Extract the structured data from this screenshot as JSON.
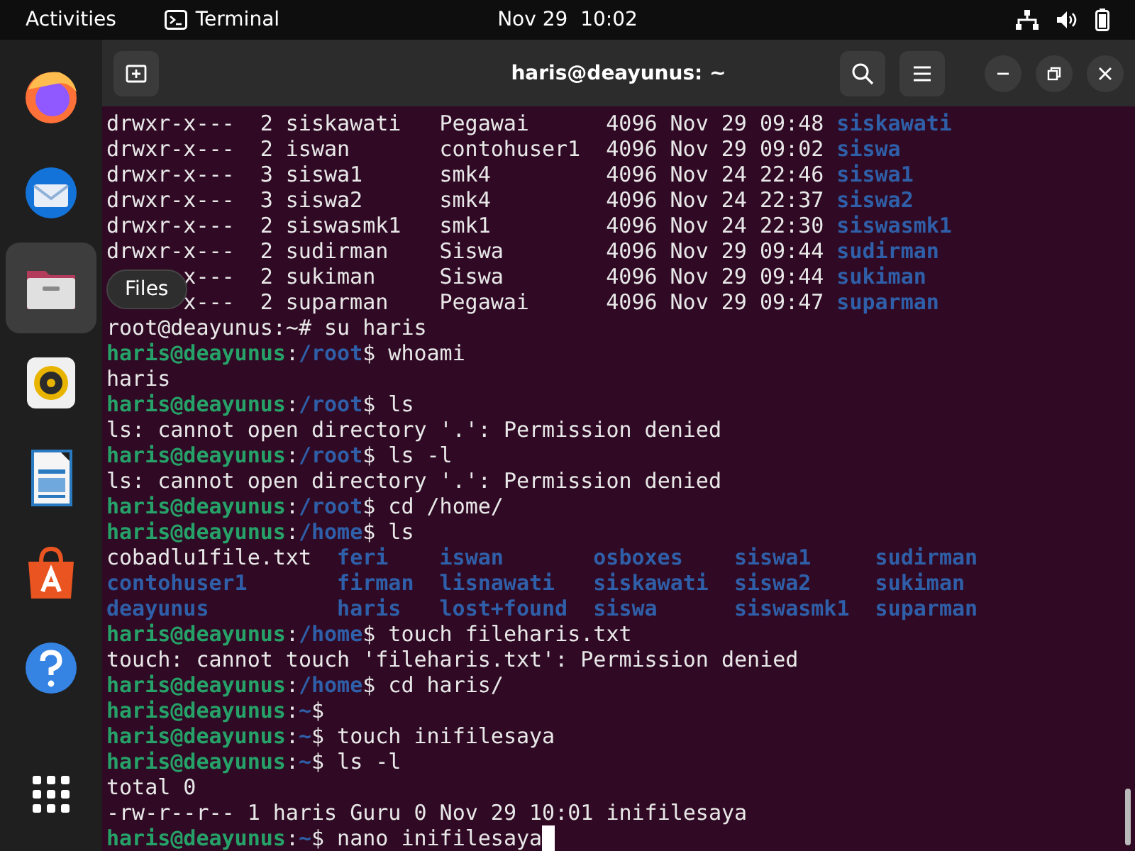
{
  "top_bar": {
    "activities": "Activities",
    "app_name": "Terminal",
    "clock": "Nov 29  10:02"
  },
  "dock": {
    "items": [
      {
        "kind": "firefox",
        "selected": false
      },
      {
        "kind": "thunderbird",
        "selected": false
      },
      {
        "kind": "files",
        "selected": true
      },
      {
        "kind": "rhythmbox",
        "selected": false
      },
      {
        "kind": "writer",
        "selected": false
      },
      {
        "kind": "software",
        "selected": false
      },
      {
        "kind": "help",
        "selected": false
      },
      {
        "kind": "apps",
        "selected": false
      }
    ],
    "tooltip": "Files"
  },
  "window": {
    "title": "haris@deayunus: ~"
  },
  "terminal": {
    "lines": [
      {
        "kind": "listing",
        "perms": "drwxr-x---",
        "links": "2",
        "owner": "siskawati",
        "group": "Pegawai",
        "size": "4096",
        "date": "Nov 29 09:48",
        "name": "siskawati"
      },
      {
        "kind": "listing",
        "perms": "drwxr-x---",
        "links": "2",
        "owner": "iswan",
        "group": "contohuser1",
        "size": "4096",
        "date": "Nov 29 09:02",
        "name": "siswa"
      },
      {
        "kind": "listing",
        "perms": "drwxr-x---",
        "links": "3",
        "owner": "siswa1",
        "group": "smk4",
        "size": "4096",
        "date": "Nov 24 22:46",
        "name": "siswa1"
      },
      {
        "kind": "listing",
        "perms": "drwxr-x---",
        "links": "3",
        "owner": "siswa2",
        "group": "smk4",
        "size": "4096",
        "date": "Nov 24 22:37",
        "name": "siswa2"
      },
      {
        "kind": "listing",
        "perms": "drwxr-x---",
        "links": "2",
        "owner": "siswasmk1",
        "group": "smk1",
        "size": "4096",
        "date": "Nov 24 22:30",
        "name": "siswasmk1"
      },
      {
        "kind": "listing",
        "perms": "drwxr-x---",
        "links": "2",
        "owner": "sudirman",
        "group": "Siswa",
        "size": "4096",
        "date": "Nov 29 09:44",
        "name": "sudirman"
      },
      {
        "kind": "listing",
        "perms_tail": "x---",
        "links": "2",
        "owner": "sukiman",
        "group": "Siswa",
        "size": "4096",
        "date": "Nov 29 09:44",
        "name": "sukiman"
      },
      {
        "kind": "listing",
        "perms_tail": "x---",
        "links": "2",
        "owner": "suparman",
        "group": "Pegawai",
        "size": "4096",
        "date": "Nov 29 09:47",
        "name": "suparman"
      },
      {
        "kind": "text",
        "text": "root@deayunus:~# su haris"
      },
      {
        "kind": "prompt",
        "user": "haris@deayunus",
        "colon": ":",
        "path": "/root",
        "sigil": "$",
        "command": "whoami"
      },
      {
        "kind": "text",
        "text": "haris"
      },
      {
        "kind": "prompt",
        "user": "haris@deayunus",
        "colon": ":",
        "path": "/root",
        "sigil": "$",
        "command": "ls"
      },
      {
        "kind": "text",
        "text": "ls: cannot open directory '.': Permission denied"
      },
      {
        "kind": "prompt",
        "user": "haris@deayunus",
        "colon": ":",
        "path": "/root",
        "sigil": "$",
        "command": "ls -l"
      },
      {
        "kind": "text",
        "text": "ls: cannot open directory '.': Permission denied"
      },
      {
        "kind": "prompt",
        "user": "haris@deayunus",
        "colon": ":",
        "path": "/root",
        "sigil": "$",
        "command": "cd /home/"
      },
      {
        "kind": "prompt",
        "user": "haris@deayunus",
        "colon": ":",
        "path": "/home",
        "sigil": "$",
        "command": "ls"
      },
      {
        "kind": "columns",
        "entries": [
          {
            "name": "cobadlu1file.txt",
            "kind": "file"
          },
          {
            "name": "feri",
            "kind": "dir"
          },
          {
            "name": "iswan",
            "kind": "dir"
          },
          {
            "name": "osboxes",
            "kind": "dir"
          },
          {
            "name": "siswa1",
            "kind": "dir"
          },
          {
            "name": "sudirman",
            "kind": "dir"
          }
        ]
      },
      {
        "kind": "columns",
        "entries": [
          {
            "name": "contohuser1",
            "kind": "dir"
          },
          {
            "name": "firman",
            "kind": "dir"
          },
          {
            "name": "lisnawati",
            "kind": "dir"
          },
          {
            "name": "siskawati",
            "kind": "dir"
          },
          {
            "name": "siswa2",
            "kind": "dir"
          },
          {
            "name": "sukiman",
            "kind": "dir"
          }
        ]
      },
      {
        "kind": "columns",
        "entries": [
          {
            "name": "deayunus",
            "kind": "dir"
          },
          {
            "name": "haris",
            "kind": "dir"
          },
          {
            "name": "lost+found",
            "kind": "dir"
          },
          {
            "name": "siswa",
            "kind": "dir"
          },
          {
            "name": "siswasmk1",
            "kind": "dir"
          },
          {
            "name": "suparman",
            "kind": "dir"
          }
        ]
      },
      {
        "kind": "prompt",
        "user": "haris@deayunus",
        "colon": ":",
        "path": "/home",
        "sigil": "$",
        "command": "touch fileharis.txt"
      },
      {
        "kind": "text",
        "text": "touch: cannot touch 'fileharis.txt': Permission denied"
      },
      {
        "kind": "prompt",
        "user": "haris@deayunus",
        "colon": ":",
        "path": "/home",
        "sigil": "$",
        "command": "cd haris/"
      },
      {
        "kind": "prompt",
        "user": "haris@deayunus",
        "colon": ":",
        "path": "~",
        "sigil": "$"
      },
      {
        "kind": "prompt",
        "user": "haris@deayunus",
        "colon": ":",
        "path": "~",
        "sigil": "$",
        "command": "touch inifilesaya"
      },
      {
        "kind": "prompt",
        "user": "haris@deayunus",
        "colon": ":",
        "path": "~",
        "sigil": "$",
        "command": "ls -l"
      },
      {
        "kind": "text",
        "text": "total 0"
      },
      {
        "kind": "text",
        "text": "-rw-r--r-- 1 haris Guru 0 Nov 29 10:01 inifilesaya"
      },
      {
        "kind": "prompt",
        "user": "haris@deayunus",
        "colon": ":",
        "path": "~",
        "sigil": "$",
        "command": "nano inifilesaya",
        "cursor": true
      }
    ]
  }
}
